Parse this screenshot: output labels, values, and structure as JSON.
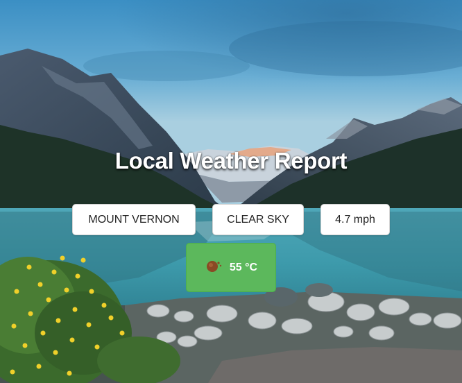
{
  "app": {
    "title": "Local Weather Report"
  },
  "weather": {
    "location": "MOUNT VERNON",
    "condition": "CLEAR SKY",
    "wind": "4.7 mph",
    "temperature": "55 °C",
    "icon": "clear-sky-icon"
  },
  "colors": {
    "temp_button": "#5cb85c",
    "chip_background": "#ffffff",
    "title_text": "#ffffff"
  }
}
